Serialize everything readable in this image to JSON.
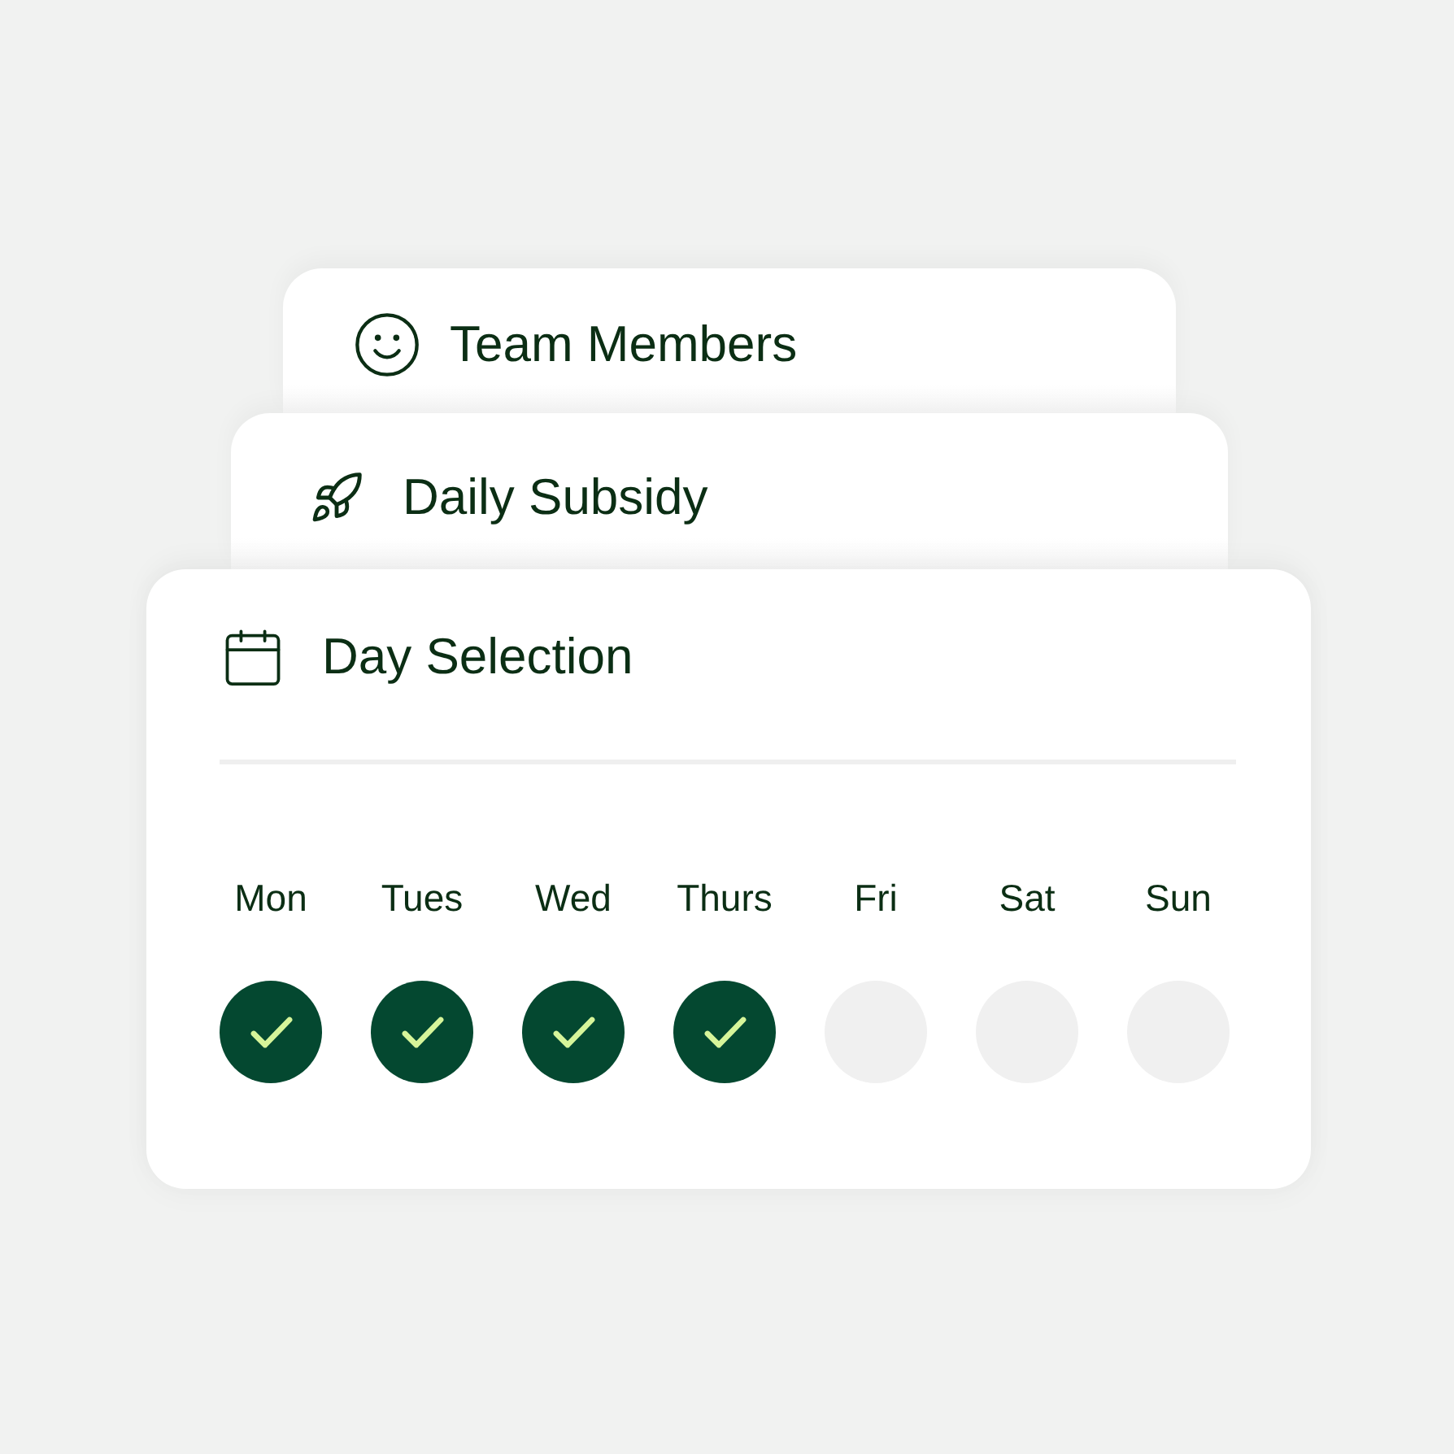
{
  "cards": [
    {
      "title": "Team Members"
    },
    {
      "title": "Daily Subsidy"
    }
  ],
  "day_selection": {
    "title": "Day Selection",
    "days": [
      {
        "label": "Mon",
        "checked": true
      },
      {
        "label": "Tues",
        "checked": true
      },
      {
        "label": "Wed",
        "checked": true
      },
      {
        "label": "Thurs",
        "checked": true
      },
      {
        "label": "Fri",
        "checked": false
      },
      {
        "label": "Sat",
        "checked": false
      },
      {
        "label": "Sun",
        "checked": false
      }
    ]
  }
}
